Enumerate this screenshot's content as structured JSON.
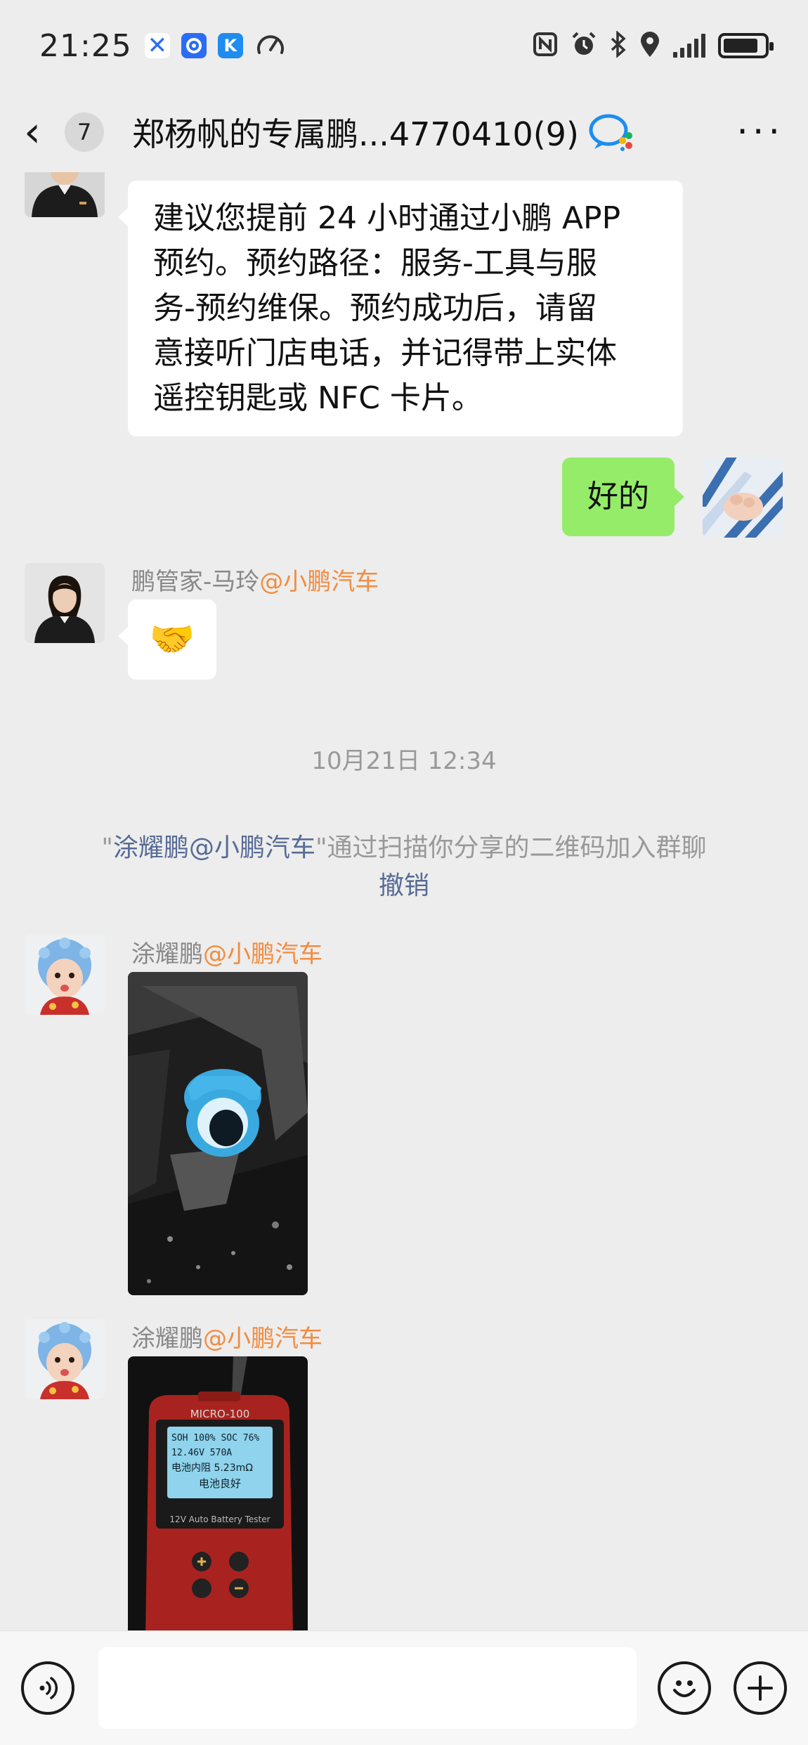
{
  "status_bar": {
    "time": "21:25",
    "icons": [
      "x-app-icon",
      "camera-app-icon",
      "k-app-icon",
      "speedometer-icon",
      "nfc-icon",
      "alarm-icon",
      "bluetooth-icon",
      "location-icon",
      "signal-icon",
      "battery-icon"
    ]
  },
  "header": {
    "back_icon": "‹",
    "unread_count": "7",
    "title": "郑杨帆的专属鹏...4770410(9)",
    "more_icon": "···"
  },
  "messages": {
    "m1": {
      "text_lines": [
        "建议您提前 24 小时通过小鹏 APP",
        "预约。预约路径：服务-工具与服",
        "务-预约维保。预约成功后，请留",
        "意接听门店电话，并记得带上实体",
        "遥控钥匙或 NFC 卡片。"
      ]
    },
    "m2": {
      "text": "好的"
    },
    "m3": {
      "sender": "鹏管家-马玲",
      "org": "@小鹏汽车",
      "emoji": "🤝"
    },
    "time_divider": "10月21日 12:34",
    "sys": {
      "quote_open": "\"",
      "name": "涂耀鹏@小鹏汽车",
      "rest": "\"通过扫描你分享的二维码加入群聊",
      "revoke": "撤销"
    },
    "m4": {
      "sender": "涂耀鹏",
      "org": "@小鹏汽车"
    },
    "m5": {
      "sender": "涂耀鹏",
      "org": "@小鹏汽车",
      "device_model": "MICRO-100",
      "screen_line1": "SOH 100% SOC 76%",
      "screen_line2": "12.46V      570A",
      "screen_line3": "电池内阻 5.23mΩ",
      "screen_line4": "电池良好",
      "device_caption": "12V Auto Battery Tester"
    }
  },
  "input_bar": {
    "voice_icon": "voice-icon",
    "emoji_icon": "emoji-icon",
    "plus_icon": "plus-icon"
  }
}
